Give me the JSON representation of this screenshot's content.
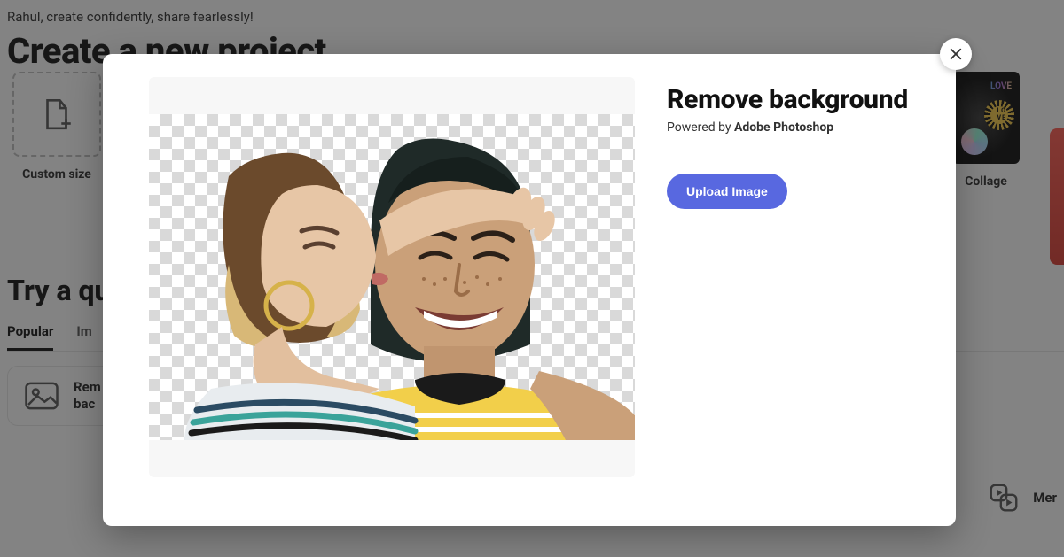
{
  "greeting": "Rahul, create confidently, share fearlessly!",
  "main_heading": "Create a new project",
  "templates": {
    "custom_size_label": "Custom size",
    "collage_label": "Collage",
    "collage_badge_text": "LOVE"
  },
  "quick_heading": "Try a quick",
  "tabs": {
    "popular": "Popular",
    "second_partial": "Im"
  },
  "actions": {
    "remove_bg_line1": "Rem",
    "remove_bg_line2": "bac",
    "right_partial": "Mer"
  },
  "modal": {
    "title": "Remove background",
    "powered_by_prefix": "Powered by ",
    "powered_by_brand": "Adobe Photoshop",
    "upload_label": "Upload Image"
  }
}
